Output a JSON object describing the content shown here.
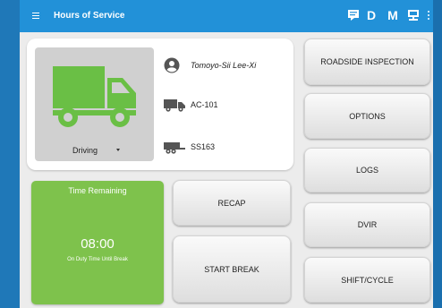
{
  "appbar": {
    "title": "Hours of Service",
    "actions": [
      {
        "icon": "message-icon"
      },
      {
        "label": "D"
      },
      {
        "label": "M"
      },
      {
        "icon": "device-icon"
      },
      {
        "icon": "more-vert-icon"
      }
    ]
  },
  "status_card": {
    "duty_status": "Driving",
    "driver_name": "Tomoyo-Sii Lee-Xi",
    "vehicle": "AC-101",
    "trailer": "SS163",
    "icons": {
      "status": "truck-icon",
      "driver": "account-circle-icon",
      "vehicle": "vehicle-icon",
      "trailer": "trailer-icon"
    }
  },
  "time_card": {
    "title": "Time Remaining",
    "value": "08:00",
    "subtitle": "On Duty Time Until Break"
  },
  "buttons": {
    "recap": "RECAP",
    "start_break": "START BREAK",
    "roadside_inspection": "ROADSIDE INSPECTION",
    "options": "OPTIONS",
    "logs": "LOGS",
    "dvir": "DVIR",
    "shift_cycle": "SHIFT/CYCLE"
  },
  "colors": {
    "appbar": "#2291d8",
    "background": "#1769a6",
    "truck_green": "#6abf45",
    "time_card_green": "#7ec24c"
  }
}
